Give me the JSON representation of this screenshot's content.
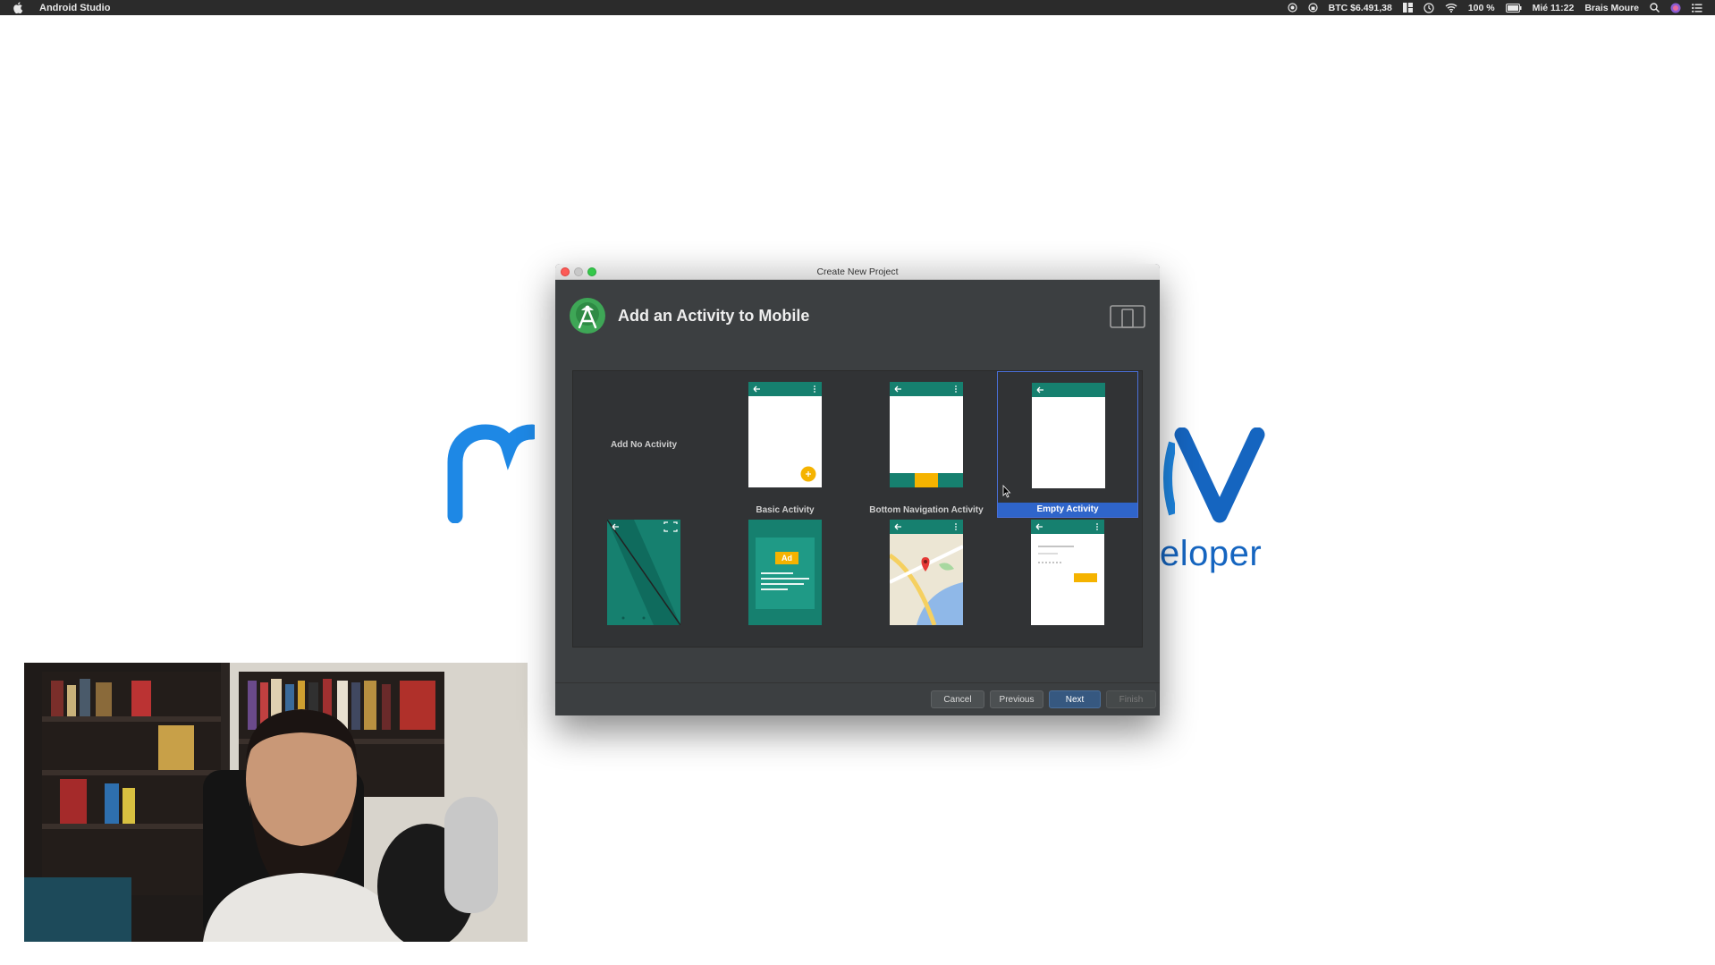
{
  "menubar": {
    "app_name": "Android Studio",
    "btc": "BTC $6.491,38",
    "battery": "100 %",
    "clock": "Mié 11:22",
    "user": "Brais Moure"
  },
  "background": {
    "logo_fragment_right": "eloper",
    "logo_color": "#1e88e5"
  },
  "dialog": {
    "window_title": "Create New Project",
    "heading": "Add an Activity to Mobile",
    "templates": [
      {
        "label": "Add No Activity"
      },
      {
        "label": "Basic Activity"
      },
      {
        "label": "Bottom Navigation Activity"
      },
      {
        "label": "Empty Activity",
        "selected": true
      },
      {
        "label": ""
      },
      {
        "label": ""
      },
      {
        "label": ""
      },
      {
        "label": ""
      }
    ],
    "ad_badge": "Ad",
    "buttons": {
      "cancel": "Cancel",
      "previous": "Previous",
      "next": "Next",
      "finish": "Finish"
    }
  },
  "colors": {
    "teal": "#16806f",
    "teal_dark": "#0f6b5d",
    "amber": "#f5b300",
    "selection": "#2f65ca"
  }
}
